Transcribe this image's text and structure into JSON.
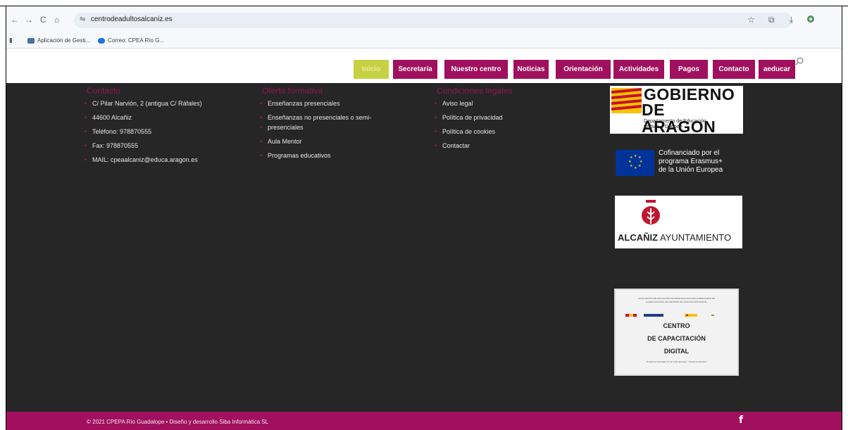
{
  "browser": {
    "back": "←",
    "forward": "→",
    "reload": "C",
    "home": "⌂",
    "tune_icon": "⇋",
    "url": "centrodeadultosalcaniz.es",
    "bookmarks": [
      {
        "label": "Aplicación de Gesti...",
        "icon": "app-icon",
        "color": "#4a6fa5"
      },
      {
        "label": "Correo: CPEA Río G...",
        "icon": "mail-icon",
        "color": "#1a73e8"
      }
    ]
  },
  "nav": {
    "items": [
      {
        "label": "Inicio",
        "active": true
      },
      {
        "label": "Secretaría"
      },
      {
        "label": "Nuestro centro"
      },
      {
        "label": "Noticias"
      },
      {
        "label": "Orientación"
      },
      {
        "label": "Actividades"
      },
      {
        "label": "Pagos"
      },
      {
        "label": "Contacto"
      },
      {
        "label": "aeducar"
      }
    ],
    "search_icon": "search-icon"
  },
  "footer": {
    "contacto": {
      "title": "Contacto",
      "items": [
        "C/ Pilar Narvión, 2 (antigua C/ Ráfales)",
        "44600 Alcañiz",
        "Teléfono: 978870555",
        "Fax: 978870555",
        "MAIL: cpeaalcaniz@educa.aragon.es"
      ]
    },
    "oferta": {
      "title": "Oferta formativa",
      "items": [
        "Enseñanzas presenciales",
        "Enseñanzas no presenciales o semi-",
        "presenciales",
        "Aula Mentor",
        "Programas educativos"
      ]
    },
    "legales": {
      "title": "Condiciones legales",
      "items": [
        "Aviso legal",
        "Política de privacidad",
        "Política de cookies",
        "Contactar"
      ]
    }
  },
  "logos": {
    "gobierno": {
      "line1": "GOBIERNO",
      "line2": "DE ARAGON",
      "dept1": "Departamento de Educación,",
      "dept2": "Cultura y Deporte"
    },
    "erasmus": {
      "line1": "Cofinanciado por el",
      "line2": "programa Erasmus+",
      "line3": "de la Unión Europea"
    },
    "alcaniz": {
      "bold": "ALCAÑIZ",
      "rest": " AYUNTAMIENTO"
    },
    "capacitacion": {
      "small1": "ESTE CENTRO DE EDUCACIÓN DE PERSONAS ADULTAS FORMA PARTE DE",
      "small2": "LA RED NACIONAL DE CENTROS DE CAPACITACIÓN DIGITAL",
      "title1": "CENTRO",
      "title2": "DE CAPACITACIÓN",
      "title3": "DIGITAL",
      "footnote": "Programa financiado por la Unión Europea - NextGenerationEU"
    }
  },
  "bottom": {
    "copyright": "© 2021 CPEPA Río Guadalope • Diseño y desarrollo Siba Informática SL",
    "facebook": "f"
  },
  "colors": {
    "brand": "#a0105e",
    "active": "#c8d143",
    "dark_bg": "#262626"
  }
}
